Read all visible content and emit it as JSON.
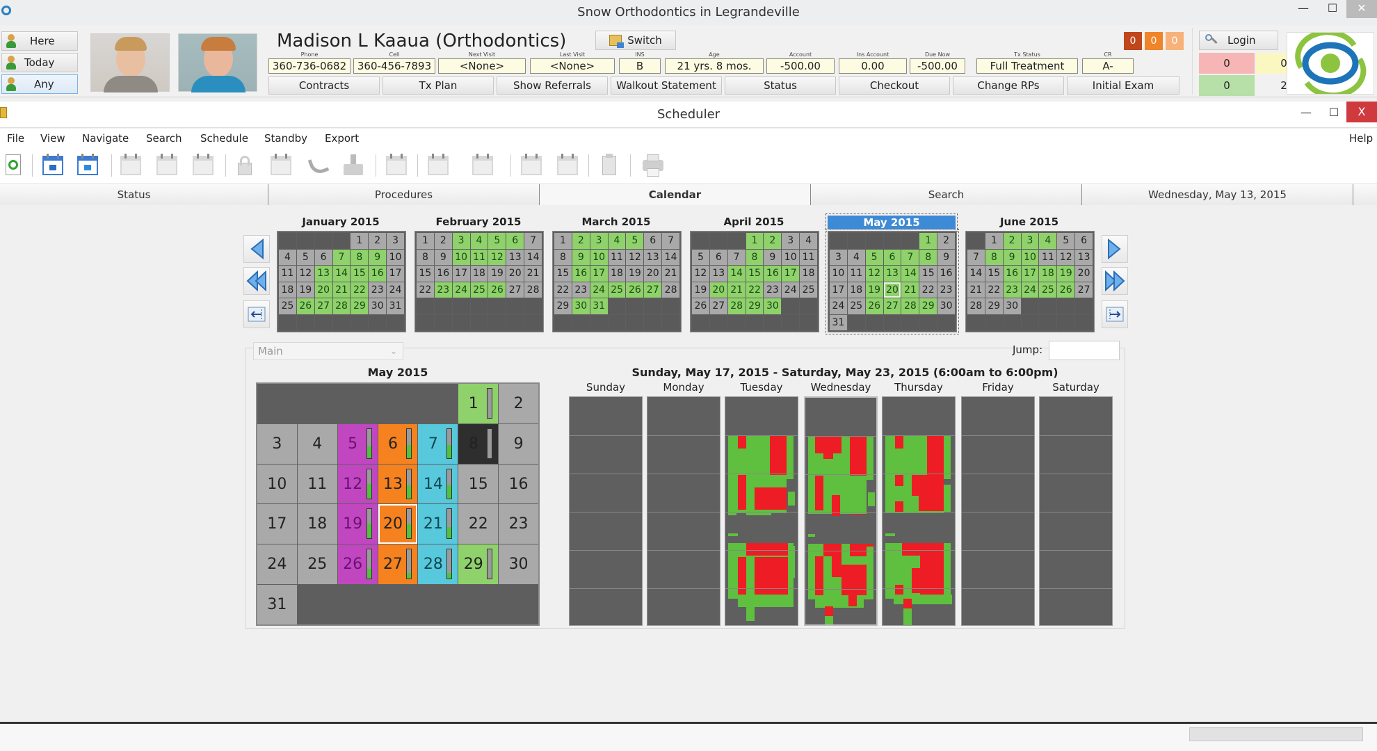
{
  "app": {
    "title": "Snow Orthodontics in Legrandeville",
    "window_controls": {
      "minimize": "—",
      "maximize": "☐",
      "close": "✕"
    }
  },
  "header": {
    "quick_buttons": [
      {
        "label": "Here",
        "icon": "person-icon"
      },
      {
        "label": "Today",
        "icon": "person-icon"
      },
      {
        "label": "Any",
        "icon": "person-icon",
        "selected": true
      }
    ],
    "patient_name": "Madison L Kaaua  (Orthodontics)",
    "switch_label": "Switch",
    "fields": [
      {
        "label": "Phone",
        "value": "360-736-0682"
      },
      {
        "label": "Cell",
        "value": "360-456-7893"
      },
      {
        "label": "Next Visit",
        "value": "<None>"
      },
      {
        "label": "Last Visit",
        "value": "<None>"
      },
      {
        "label": "INS",
        "value": "B"
      },
      {
        "label": "Age",
        "value": "21 yrs. 8 mos."
      },
      {
        "label": "Account",
        "value": "-500.00"
      },
      {
        "label": "Ins Account",
        "value": "0.00"
      },
      {
        "label": "Due Now",
        "value": "-500.00"
      },
      {
        "label": "Tx Status",
        "value": "Full Treatment"
      },
      {
        "label": "CR",
        "value": "A-"
      }
    ],
    "buttons": [
      "Contracts",
      "Tx Plan",
      "Show Referrals",
      "Walkout Statement",
      "Status",
      "Checkout",
      "Change RPs",
      "Initial Exam"
    ],
    "badges": [
      {
        "value": "0",
        "color": "#c0461c"
      },
      {
        "value": "0",
        "color": "#f08428"
      },
      {
        "value": "0",
        "color": "#f7b27a"
      }
    ],
    "login_label": "Login",
    "counters": [
      {
        "value": "0",
        "color": "#f7b6b6"
      },
      {
        "value": "0",
        "color": "#fbf7c0"
      },
      {
        "value": "0",
        "color": "#b7e0a8"
      },
      {
        "value": "2",
        "color": "#f1f1f1"
      }
    ]
  },
  "scheduler": {
    "title": "Scheduler",
    "window_controls": {
      "minimize": "—",
      "maximize": "☐",
      "close": "X"
    },
    "menu": [
      "File",
      "View",
      "Navigate",
      "Search",
      "Schedule",
      "Standby",
      "Export"
    ],
    "help_label": "Help",
    "toolbar_icons": [
      "refresh-icon",
      "calendar-icon",
      "calendar-goto-icon",
      "calendar-search-icon",
      "calendar-search-2-icon",
      "calendar-search-3-icon",
      "lock-icon",
      "calendar-edit-icon",
      "phone-icon",
      "inbox-icon",
      "calendar-check-icon",
      "calendar-move-icon",
      "calendar-move-2-icon",
      "calendar-import-icon",
      "calendar-import-2-icon",
      "clipboard-icon",
      "printer-icon"
    ],
    "tabs": [
      {
        "label": "Status"
      },
      {
        "label": "Procedures"
      },
      {
        "label": "Calendar",
        "active": true
      },
      {
        "label": "Search"
      },
      {
        "label": "Wednesday, May 13, 2015"
      }
    ],
    "mini_calendars": [
      {
        "title": "January 2015",
        "offset": 4,
        "days": 31,
        "green": [
          7,
          8,
          9,
          13,
          14,
          15,
          16,
          20,
          21,
          22,
          26,
          27,
          28,
          29
        ]
      },
      {
        "title": "February 2015",
        "offset": 0,
        "days": 28,
        "green": [
          3,
          4,
          5,
          6,
          10,
          11,
          12,
          23,
          24,
          25,
          26
        ]
      },
      {
        "title": "March 2015",
        "offset": 0,
        "days": 31,
        "green": [
          2,
          3,
          4,
          5,
          9,
          10,
          16,
          17,
          24,
          25,
          26,
          27,
          30,
          31
        ]
      },
      {
        "title": "April 2015",
        "offset": 3,
        "days": 30,
        "green": [
          1,
          2,
          8,
          14,
          15,
          16,
          17,
          20,
          21,
          22,
          28,
          29,
          30
        ]
      },
      {
        "title": "May 2015",
        "offset": 5,
        "days": 31,
        "green": [
          1,
          5,
          6,
          7,
          8,
          12,
          13,
          14,
          19,
          20,
          21,
          26,
          27,
          28,
          29
        ],
        "today": 20,
        "selected": true
      },
      {
        "title": "June 2015",
        "offset": 1,
        "days": 30,
        "green": [
          2,
          3,
          4,
          8,
          9,
          10,
          16,
          17,
          18,
          19,
          23,
          24,
          25,
          26
        ]
      }
    ],
    "resource_select": "Main",
    "jump_label": "Jump:",
    "jump_value": "",
    "month_view": {
      "title": "May 2015",
      "offset": 5,
      "days": 31,
      "day_styles": {
        "1": {
          "color": "g",
          "fill": 0
        },
        "5": {
          "color": "m",
          "fill": 0.4
        },
        "6": {
          "color": "o",
          "fill": 0.45
        },
        "7": {
          "color": "c",
          "fill": 0.45
        },
        "8": {
          "color": "k",
          "fill": 0
        },
        "12": {
          "color": "m",
          "fill": 0.5
        },
        "13": {
          "color": "o",
          "fill": 0.45
        },
        "14": {
          "color": "c",
          "fill": 0.45
        },
        "19": {
          "color": "m",
          "fill": 0.5
        },
        "20": {
          "color": "o",
          "fill": 0.5,
          "selected": true
        },
        "21": {
          "color": "c",
          "fill": 0.4
        },
        "26": {
          "color": "m",
          "fill": 0.35
        },
        "27": {
          "color": "o",
          "fill": 0.2
        },
        "28": {
          "color": "c",
          "fill": 0.2
        },
        "29": {
          "color": "g",
          "fill": 0
        }
      }
    },
    "week_view": {
      "title": "Sunday, May 17, 2015 - Saturday, May 23, 2015 (6:00am to 6:00pm)",
      "days": [
        "Sunday",
        "Monday",
        "Tuesday",
        "Wednesday",
        "Thursday",
        "Friday",
        "Saturday"
      ],
      "selected_day": "Wednesday",
      "colors": {
        "open": "#5fbf3f",
        "booked": "#ee1c24",
        "empty": "#5f5f5f"
      }
    }
  }
}
